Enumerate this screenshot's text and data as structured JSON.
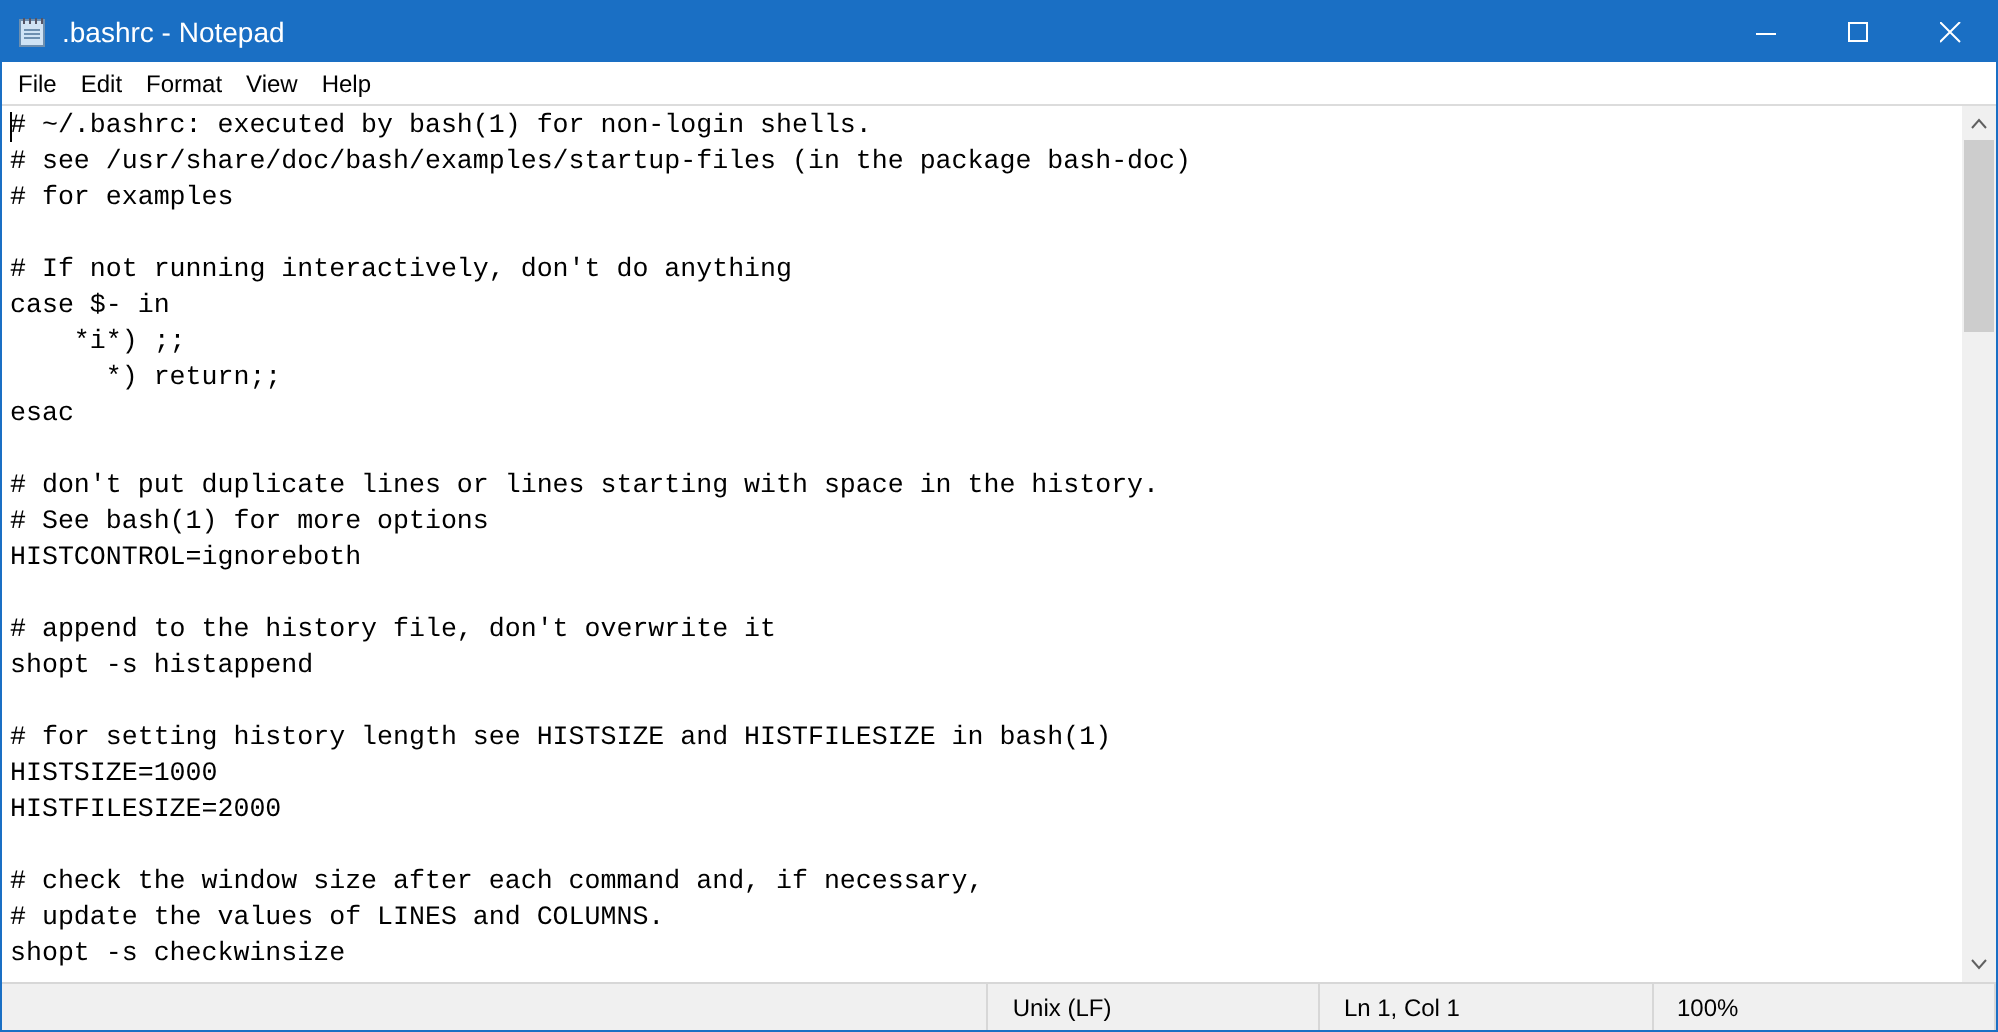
{
  "window": {
    "title": ".bashrc - Notepad"
  },
  "menu": [
    "File",
    "Edit",
    "Format",
    "View",
    "Help"
  ],
  "editor": {
    "text": "# ~/.bashrc: executed by bash(1) for non-login shells.\n# see /usr/share/doc/bash/examples/startup-files (in the package bash-doc)\n# for examples\n\n# If not running interactively, don't do anything\ncase $- in\n    *i*) ;;\n      *) return;;\nesac\n\n# don't put duplicate lines or lines starting with space in the history.\n# See bash(1) for more options\nHISTCONTROL=ignoreboth\n\n# append to the history file, don't overwrite it\nshopt -s histappend\n\n# for setting history length see HISTSIZE and HISTFILESIZE in bash(1)\nHISTSIZE=1000\nHISTFILESIZE=2000\n\n# check the window size after each command and, if necessary,\n# update the values of LINES and COLUMNS.\nshopt -s checkwinsize"
  },
  "status_bar": [
    "Unix (LF)",
    "Ln 1, Col 1",
    "100%"
  ]
}
